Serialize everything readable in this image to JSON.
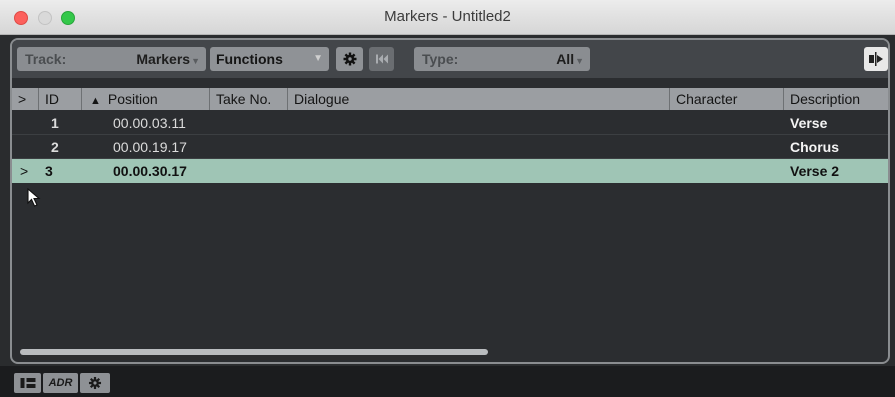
{
  "window": {
    "title": "Markers - Untitled2"
  },
  "toolbar": {
    "track_label": "Track:",
    "track_value": "Markers",
    "functions_label": "Functions",
    "type_label": "Type:",
    "type_value": "All"
  },
  "table": {
    "columns": [
      ">",
      "ID",
      "Position",
      "Take No.",
      "Dialogue",
      "Character",
      "Description"
    ],
    "rows": [
      {
        "cursor": "",
        "id": "1",
        "position": "00.00.03.11",
        "take": "",
        "dialogue": "",
        "character": "",
        "description": "Verse"
      },
      {
        "cursor": "",
        "id": "2",
        "position": "00.00.19.17",
        "take": "",
        "dialogue": "",
        "character": "",
        "description": "Chorus"
      },
      {
        "cursor": ">",
        "id": "3",
        "position": "00.00.30.17",
        "take": "",
        "dialogue": "",
        "character": "",
        "description": "Verse 2"
      }
    ],
    "selected_row": 2
  },
  "bottombar": {
    "adr_label": "ADR"
  },
  "colors": {
    "selection": "#9fc5b5",
    "header": "#9b9ea2",
    "toolbar": "#43464a"
  },
  "icons": [
    "gear-icon",
    "rewind-icon",
    "panel-toggle-icon",
    "list-view-icon",
    "settings-icon",
    "mouse-cursor"
  ]
}
